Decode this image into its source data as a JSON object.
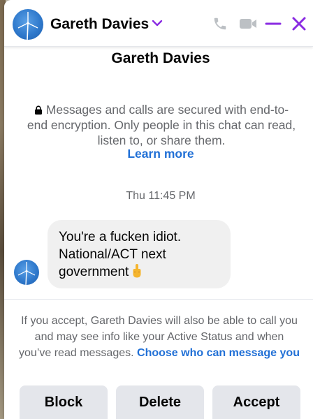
{
  "header": {
    "contact_name": "Gareth Davies",
    "accent_color": "#8a2be2"
  },
  "conversation": {
    "title": "Gareth Davies",
    "encryption_notice": "Messages and calls are secured with end-to-end encryption. Only people in this chat can read, listen to, or share them.",
    "learn_more": "Learn more",
    "timestamp": "Thu 11:45 PM",
    "messages": [
      {
        "sender": "Gareth Davies",
        "text": "You're a fucken idiot. National/ACT next government",
        "emoji": "middle-finger"
      }
    ]
  },
  "request": {
    "note": "If you accept, Gareth Davies will also be able to call you and may see info like your Active Status and when you’ve read messages.",
    "link": "Choose who can message you"
  },
  "actions": {
    "block": "Block",
    "delete": "Delete",
    "accept": "Accept"
  },
  "colors": {
    "link": "#2170d6",
    "bubble": "#f0f0f0",
    "button": "#e4e6eb"
  }
}
